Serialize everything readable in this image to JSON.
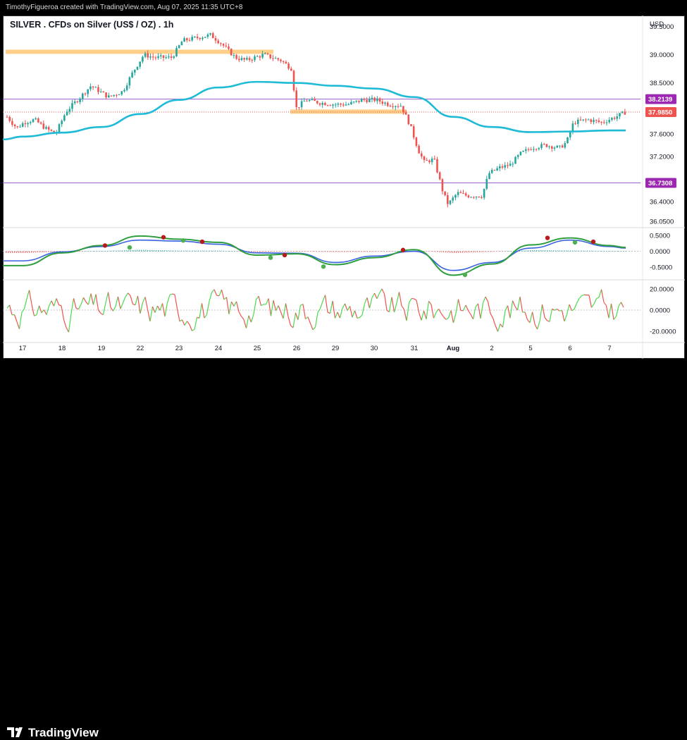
{
  "credit": "TimothyFigueroa created with TradingView.com, Aug 07, 2025 11:35 UTC+8",
  "title": "SILVER . CFDs on Silver (US$ / OZ) . 1h",
  "brand": "TradingView",
  "currency": "USD",
  "colors": {
    "up": "#26a69a",
    "down": "#ef5350",
    "ma": "#1fbad6",
    "hline": "#9c5ec9",
    "zone": "#ffcf8a",
    "macd_fast": "#2e9e3e",
    "macd_slow": "#3a61e0",
    "osc_up": "#4cd94c",
    "osc_down": "#ef5350"
  },
  "price_axis": {
    "ticks": [
      "39.5000",
      "39.0000",
      "38.5000",
      "37.6000",
      "37.2000",
      "36.4000",
      "36.0500"
    ],
    "tick_values": [
      39.5,
      39.0,
      38.5,
      37.6,
      37.2,
      36.4,
      36.05
    ],
    "range": [
      35.95,
      39.62
    ]
  },
  "price_tags": [
    {
      "label": "38.2139",
      "value": 38.2139,
      "color": "#9c27b0"
    },
    {
      "label": "37.9850",
      "value": 37.985,
      "color": "#ef5350"
    },
    {
      "label": "36.7308",
      "value": 36.7308,
      "color": "#9c27b0"
    }
  ],
  "macd_axis": {
    "ticks": [
      "0.5000",
      "0.0000",
      "-0.5000"
    ],
    "tick_values": [
      0.5,
      0.0,
      -0.5
    ],
    "range": [
      -0.85,
      0.72
    ]
  },
  "osc_axis": {
    "ticks": [
      "20.0000",
      "0.0000",
      "-20.0000"
    ],
    "tick_values": [
      20,
      0,
      -20
    ],
    "range": [
      -28,
      28
    ]
  },
  "x_axis": {
    "labels": [
      "17",
      "18",
      "19",
      "22",
      "23",
      "24",
      "25",
      "26",
      "29",
      "30",
      "31",
      "Aug",
      "2",
      "5",
      "6",
      "7"
    ],
    "bold": [
      "Aug"
    ]
  },
  "chart_data": {
    "type": "candlestick",
    "title": "SILVER . CFDs on Silver (US$ / OZ) . 1h",
    "categories": [
      "17",
      "18",
      "19",
      "22",
      "23",
      "24",
      "25",
      "26",
      "29",
      "30",
      "31",
      "Aug",
      "2",
      "5",
      "6",
      "7"
    ],
    "session_close": [
      37.82,
      37.95,
      38.18,
      38.95,
      39.15,
      39.35,
      38.98,
      38.22,
      38.16,
      38.18,
      37.45,
      36.55,
      36.95,
      37.36,
      37.8,
      37.97
    ],
    "moving_average": [
      37.55,
      37.62,
      37.72,
      37.95,
      38.2,
      38.42,
      38.52,
      38.5,
      38.45,
      38.4,
      38.25,
      37.9,
      37.72,
      37.63,
      37.64,
      37.66
    ],
    "horizontal_lines": [
      38.2139,
      36.7308
    ],
    "zones": [
      {
        "from": 39.03,
        "to": 39.09
      },
      {
        "from": 37.98,
        "to": 38.03
      }
    ],
    "last_price": 37.985,
    "macd": {
      "fast": [
        -0.45,
        -0.05,
        0.18,
        0.48,
        0.38,
        0.28,
        -0.12,
        -0.08,
        -0.42,
        -0.2,
        0.05,
        -0.75,
        -0.4,
        0.2,
        0.42,
        0.18
      ],
      "slow": [
        -0.3,
        -0.02,
        0.15,
        0.35,
        0.32,
        0.22,
        -0.05,
        -0.06,
        -0.35,
        -0.15,
        0.0,
        -0.6,
        -0.35,
        0.1,
        0.35,
        0.15
      ],
      "ylim": [
        -0.85,
        0.72
      ]
    },
    "oscillator": {
      "ylim": [
        -28,
        28
      ],
      "zero": 0
    }
  }
}
